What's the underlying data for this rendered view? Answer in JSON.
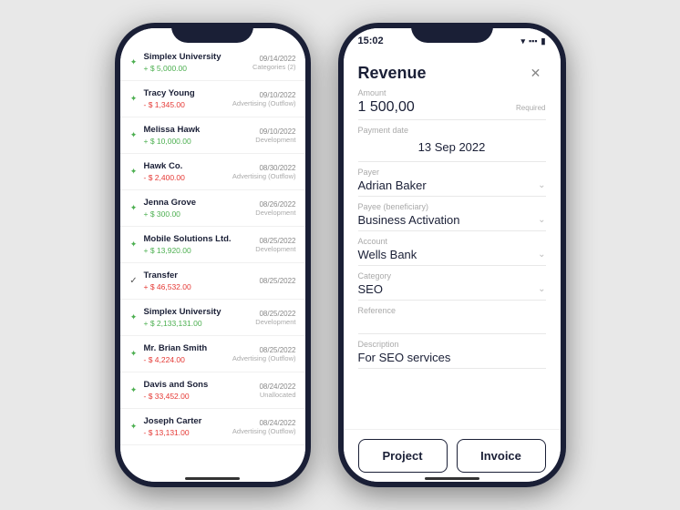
{
  "left_phone": {
    "transactions": [
      {
        "icon": "leaf",
        "name": "Simplex University",
        "amount": "+ $ 5,000.00",
        "amountType": "positive",
        "date": "09/14/2022",
        "category": "Categories (2)"
      },
      {
        "icon": "leaf",
        "name": "Tracy Young",
        "amount": "- $ 1,345.00",
        "amountType": "negative",
        "date": "09/10/2022",
        "category": "Advertising (Outflow)"
      },
      {
        "icon": "leaf",
        "name": "Melissa Hawk",
        "amount": "+ $ 10,000.00",
        "amountType": "positive",
        "date": "09/10/2022",
        "category": "Development"
      },
      {
        "icon": "leaf",
        "name": "Hawk Co.",
        "amount": "- $ 2,400.00",
        "amountType": "negative",
        "date": "08/30/2022",
        "category": "Advertising (Outflow)"
      },
      {
        "icon": "leaf",
        "name": "Jenna Grove",
        "amount": "+ $ 300.00",
        "amountType": "positive",
        "date": "08/26/2022",
        "category": "Development"
      },
      {
        "icon": "leaf",
        "name": "Mobile Solutions Ltd.",
        "amount": "+ $ 13,920.00",
        "amountType": "positive",
        "date": "08/25/2022",
        "category": "Development"
      },
      {
        "icon": "check",
        "name": "Transfer",
        "amount": "+ $ 46,532.00",
        "amountType": "negative",
        "date": "08/25/2022",
        "category": ""
      },
      {
        "icon": "leaf",
        "name": "Simplex University",
        "amount": "+ $ 2,133,131.00",
        "amountType": "positive",
        "date": "08/25/2022",
        "category": "Development"
      },
      {
        "icon": "leaf",
        "name": "Mr. Brian Smith",
        "amount": "- $ 4,224.00",
        "amountType": "negative",
        "date": "08/25/2022",
        "category": "Advertising (Outflow)"
      },
      {
        "icon": "leaf",
        "name": "Davis and Sons",
        "amount": "- $ 33,452.00",
        "amountType": "negative",
        "date": "08/24/2022",
        "category": "Unallocated"
      },
      {
        "icon": "leaf",
        "name": "Joseph Carter",
        "amount": "- $ 13,131.00",
        "amountType": "negative",
        "date": "08/24/2022",
        "category": "Advertising (Outflow)"
      }
    ]
  },
  "right_phone": {
    "status_time": "15:02",
    "form_title": "Revenue",
    "fields": {
      "amount_label": "Amount",
      "amount_value": "1 500,00",
      "amount_required": "Required",
      "payment_date_label": "Payment date",
      "payment_date_value": "13 Sep 2022",
      "payer_label": "Payer",
      "payer_value": "Adrian Baker",
      "payee_label": "Payee (beneficiary)",
      "payee_value": "Business Activation",
      "account_label": "Account",
      "account_value": "Wells Bank",
      "category_label": "Category",
      "category_value": "SEO",
      "reference_label": "Reference",
      "reference_value": "",
      "description_label": "Description",
      "description_value": "For SEO services"
    },
    "footer_buttons": {
      "project_label": "Project",
      "invoice_label": "Invoice"
    }
  }
}
